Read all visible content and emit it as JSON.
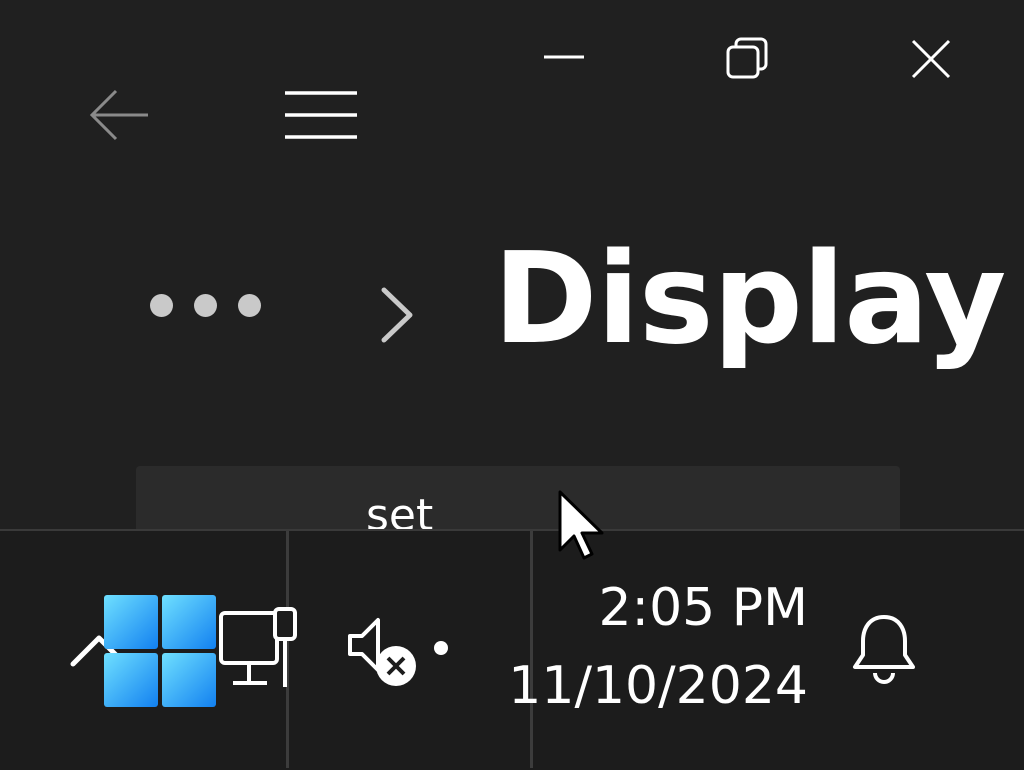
{
  "window": {
    "title_buttons": {
      "minimize_icon": "minimize-icon",
      "restore_icon": "restore-icon",
      "close_icon": "close-icon"
    }
  },
  "nav": {
    "back_icon": "back-arrow-icon",
    "menu_icon": "hamburger-menu-icon"
  },
  "breadcrumb": {
    "more_icon": "more-dots-icon",
    "separator_icon": "chevron-right-icon",
    "current": "Display"
  },
  "content": {
    "card_text": "set"
  },
  "taskbar": {
    "overflow_icon": "chevron-up-icon",
    "start_icon": "windows-start-icon",
    "network_icon": "ethernet-network-icon",
    "volume_icon": "volume-muted-icon",
    "clock": {
      "time": "2:05 PM",
      "date": "11/10/2024"
    },
    "notifications_icon": "bell-icon"
  },
  "colors": {
    "background": "#202020",
    "taskbar": "#1c1c1c",
    "card": "#2b2b2b",
    "start_gradient_start": "#6fd9ff",
    "start_gradient_end": "#1a86f5"
  }
}
